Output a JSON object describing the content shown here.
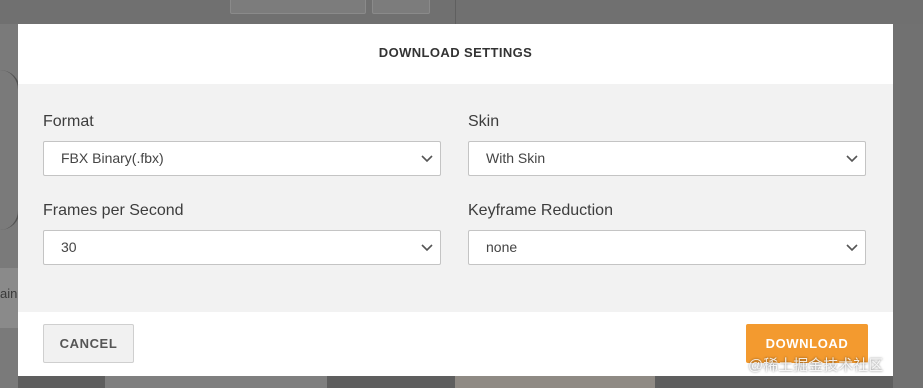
{
  "modal": {
    "title": "DOWNLOAD SETTINGS",
    "fields": {
      "format": {
        "label": "Format",
        "value": "FBX Binary(.fbx)"
      },
      "skin": {
        "label": "Skin",
        "value": "With Skin"
      },
      "fps": {
        "label": "Frames per Second",
        "value": "30"
      },
      "keyframe": {
        "label": "Keyframe Reduction",
        "value": "none"
      }
    },
    "cancel_label": "CANCEL",
    "download_label": "DOWNLOAD"
  },
  "background": {
    "partial_text": "ain"
  },
  "watermark": "@稀土掘金技术社区",
  "colors": {
    "accent": "#f39a2f",
    "body_bg": "#f2f2f2"
  },
  "icons": {
    "select_arrow": "chevron-down-icon"
  }
}
